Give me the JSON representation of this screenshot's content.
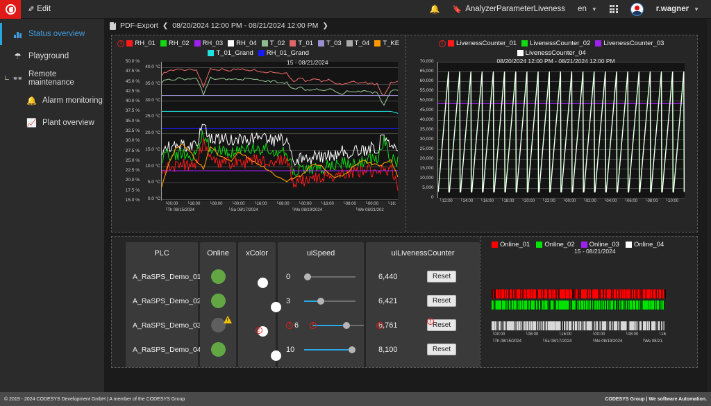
{
  "topbar": {
    "logo_name": "codesys-logo",
    "edit_label": "Edit",
    "notifications_icon": "bell-icon",
    "bookmark_label": "AnalyzerParameterLiveness",
    "language": "en",
    "apps_icon": "grid-apps-icon",
    "avatar_icon": "user-avatar",
    "user": "r.wagner"
  },
  "sidebar": {
    "items": [
      {
        "label": "Status overview",
        "icon": "bar-chart-icon",
        "active": true,
        "sub": false,
        "group": false
      },
      {
        "label": "Playground",
        "icon": "playground-icon",
        "active": false,
        "sub": false,
        "group": false
      },
      {
        "label": "Remote maintenance",
        "icon": "binoculars-icon",
        "active": false,
        "sub": false,
        "group": true
      },
      {
        "label": "Alarm monitoring",
        "icon": "alarm-bell-icon",
        "active": false,
        "sub": true,
        "group": false
      },
      {
        "label": "Plant overview",
        "icon": "plant-icon",
        "active": false,
        "sub": true,
        "group": false
      }
    ]
  },
  "breadcrumb": {
    "export_label": "PDF-Export",
    "prev_icon": "chevron-left-icon",
    "range": "08/20/2024 12:00 PM - 08/21/2024 12:00 PM",
    "next_icon": "chevron-right-icon"
  },
  "chart_data": [
    {
      "id": "trend-chart-temperature-humidity",
      "type": "line",
      "title": "15 - 08/21/2024",
      "legend_position": "top",
      "grid": true,
      "legend": [
        {
          "name": "RH_01",
          "color": "#ff1a1a",
          "error": true
        },
        {
          "name": "RH_02",
          "color": "#12d912",
          "error": false
        },
        {
          "name": "RH_03",
          "color": "#a020f0",
          "error": false
        },
        {
          "name": "RH_04",
          "color": "#ffffff",
          "error": false
        },
        {
          "name": "T_02",
          "color": "#8fbc8f",
          "error": false
        },
        {
          "name": "T_01",
          "color": "#e06666",
          "error": false
        },
        {
          "name": "T_03",
          "color": "#9b8fd4",
          "error": false
        },
        {
          "name": "T_04",
          "color": "#a9a9a9",
          "error": false
        },
        {
          "name": "T_KE",
          "color": "#ff9900",
          "error": false
        },
        {
          "name": "T_01_Grand",
          "color": "#22e0e0",
          "error": false
        },
        {
          "name": "RH_01_Grand",
          "color": "#1a1aff",
          "error": false
        }
      ],
      "yaxis_left": {
        "label": "%",
        "ticks": [
          "50.0 %",
          "47.5 %",
          "45.0 %",
          "42.5 %",
          "40.0 %",
          "37.5 %",
          "35.0 %",
          "32.5 %",
          "30.0 %",
          "27.5 %",
          "25.0 %",
          "22.5 %",
          "20.0 %",
          "17.5 %",
          "15.0 %"
        ],
        "min": 15.0,
        "max": 50.0
      },
      "yaxis_right_inner": {
        "label": "°C",
        "ticks": [
          "40.0 °C",
          "35.0 °C",
          "30.0 °C",
          "25.0 °C",
          "20.0 °C",
          "15.0 °C",
          "10.0 °C",
          "5.0 °C",
          "0.0 °C"
        ],
        "min": 0.0,
        "max": 40.0
      },
      "xaxis": {
        "ticks": [
          "00:00",
          "16:00",
          "08:00",
          "00:00",
          "16:00",
          "08:00",
          "00:00",
          "16:00",
          "08:00",
          "00:00",
          "16:"
        ],
        "day_labels": [
          "Th 08/15/2024",
          "Sa 08/17/2024",
          "Mo 08/19/2024",
          "We 08/21/202"
        ]
      },
      "series": [
        {
          "name": "T_01",
          "color": "#e06666",
          "values": [
            38.5,
            39.2,
            39.4,
            39.3,
            39.5,
            39.4,
            36.0,
            39.6,
            39.5,
            39.4,
            39.3,
            39.5,
            39.4,
            39.3,
            39.2,
            39.0,
            38.9,
            38.8,
            38.6,
            37.2,
            37.6,
            37.0,
            37.4,
            37.1,
            37.3,
            36.8,
            36.2,
            37.0,
            36.9,
            36.8,
            36.6,
            36.5,
            33.9,
            37.0,
            36.9
          ]
        },
        {
          "name": "T_02",
          "color": "#8fbc8f",
          "values": [
            37.0,
            37.4,
            37.6,
            37.5,
            37.6,
            37.5,
            34.5,
            37.7,
            37.6,
            37.5,
            37.4,
            37.6,
            37.5,
            37.4,
            37.3,
            37.1,
            37.0,
            36.9,
            36.7,
            35.4,
            35.8,
            35.2,
            35.6,
            35.3,
            35.5,
            35.0,
            34.4,
            35.2,
            35.1,
            35.0,
            34.8,
            34.7,
            32.1,
            35.2,
            35.1
          ]
        },
        {
          "name": "T_03",
          "color": "#9b8fd4",
          "values": [
            34.2,
            34.2,
            34.2,
            34.2,
            34.2,
            34.2,
            34.2,
            34.2,
            34.2,
            34.2,
            34.2,
            34.2,
            34.2,
            34.2,
            34.2,
            34.2,
            34.2,
            34.2,
            34.2,
            34.2,
            34.2,
            34.2,
            34.2,
            34.2,
            34.2,
            34.2,
            34.2,
            34.2,
            34.2,
            34.2,
            34.2,
            34.2,
            34.2,
            34.2,
            34.2
          ]
        },
        {
          "name": "T_01_Grand",
          "color": "#22e0e0",
          "values": [
            31.0,
            31.0,
            31.0,
            31.0,
            31.0,
            31.0,
            31.0,
            31.0,
            31.0,
            31.0,
            31.0,
            31.0,
            31.0,
            31.0,
            31.0,
            31.0,
            31.0,
            31.0,
            31.0,
            31.0,
            31.0,
            31.0,
            31.0,
            31.0,
            31.0,
            31.0,
            31.0,
            31.0,
            31.0,
            31.0,
            31.0,
            31.0,
            31.0,
            31.0,
            30.6
          ]
        },
        {
          "name": "RH_01_Grand",
          "color": "#1a1aff",
          "values": [
            27.5,
            27.5,
            27.5,
            27.5,
            27.5,
            27.5,
            27.5,
            27.5,
            27.5,
            27.5,
            27.5,
            27.5,
            27.5,
            27.5,
            27.5,
            27.5,
            27.5,
            27.5,
            27.5,
            27.5,
            27.5,
            27.5,
            27.5,
            27.5,
            27.5,
            27.5,
            27.5,
            27.5,
            27.5,
            27.5,
            27.5,
            27.5,
            27.5,
            27.5,
            27.5
          ]
        },
        {
          "name": "RH_04",
          "color": "#ffffff",
          "values": [
            23.5,
            24.0,
            23.8,
            24.2,
            23.9,
            24.4,
            28.5,
            25.6,
            25.2,
            25.4,
            25.1,
            25.5,
            25.2,
            25.6,
            25.3,
            25.5,
            25.0,
            25.4,
            25.1,
            20.8,
            21.5,
            21.2,
            22.0,
            21.6,
            22.4,
            22.0,
            23.0,
            22.6,
            23.4,
            23.0,
            23.6,
            23.2,
            26.8,
            23.4,
            23.0
          ]
        },
        {
          "name": "RH_02",
          "color": "#12d912",
          "values": [
            21.8,
            22.2,
            22.0,
            22.4,
            22.1,
            22.6,
            26.8,
            23.4,
            23.0,
            23.2,
            22.9,
            23.3,
            23.0,
            23.4,
            23.1,
            23.3,
            22.8,
            23.2,
            22.9,
            18.6,
            19.3,
            19.0,
            19.8,
            19.4,
            20.2,
            19.8,
            20.8,
            20.4,
            21.2,
            20.8,
            21.4,
            21.0,
            25.0,
            21.2,
            20.8
          ]
        },
        {
          "name": "RH_01",
          "color": "#ff1a1a",
          "values": [
            19.6,
            20.0,
            19.8,
            20.2,
            19.9,
            20.4,
            25.2,
            21.2,
            20.8,
            21.0,
            20.7,
            21.1,
            20.8,
            21.2,
            20.9,
            21.1,
            20.6,
            21.0,
            20.7,
            16.4,
            17.1,
            16.8,
            17.6,
            17.2,
            18.0,
            17.6,
            18.6,
            18.2,
            19.0,
            18.6,
            19.2,
            18.8,
            19.0,
            19.0,
            15.5
          ]
        },
        {
          "name": "RH_03",
          "color": "#a020f0",
          "values": [
            19.0,
            19.0,
            19.0,
            19.0,
            19.0,
            19.0,
            19.0,
            19.0,
            19.0,
            19.0,
            19.0,
            19.0,
            19.0,
            19.0,
            19.0,
            19.0,
            19.0,
            19.0,
            19.0,
            19.0,
            19.0,
            19.0,
            19.0,
            19.0,
            19.0,
            19.0,
            19.0,
            19.0,
            19.0,
            19.0,
            19.0,
            19.0,
            19.0,
            19.0,
            19.0
          ]
        },
        {
          "name": "T_KE",
          "color": "#ff9900",
          "values": [
            16.0,
            20.5,
            23.5,
            24.5,
            23.0,
            21.0,
            19.5,
            24.0,
            22.5,
            21.5,
            21.0,
            22.6,
            22.0,
            21.0,
            20.2,
            19.4,
            18.5,
            17.6,
            17.0,
            17.4,
            18.0,
            19.2,
            20.5,
            20.0,
            18.6,
            17.6,
            18.0,
            19.0,
            20.2,
            21.0,
            20.6,
            20.0,
            20.4,
            21.4,
            17.5
          ]
        }
      ]
    },
    {
      "id": "liveness-counter-chart",
      "type": "line",
      "title": "08/20/2024 12:00 PM - 08/21/2024 12:00 PM",
      "legend_position": "top",
      "grid": true,
      "legend": [
        {
          "name": "LivenessCounter_01",
          "color": "#ff1a1a",
          "error": true
        },
        {
          "name": "LivenessCounter_02",
          "color": "#12d912",
          "error": false
        },
        {
          "name": "LivenessCounter_03",
          "color": "#a020f0",
          "error": false
        },
        {
          "name": "LivenessCounter_04",
          "color": "#ffffff",
          "error": false
        }
      ],
      "yaxis": {
        "ticks": [
          "70,000",
          "65,000",
          "60,000",
          "55,000",
          "50,000",
          "45,000",
          "40,000",
          "35,000",
          "30,000",
          "25,000",
          "20,000",
          "15,000",
          "10,000",
          "5,000",
          "0"
        ],
        "min": 0,
        "max": 70000
      },
      "xaxis": {
        "ticks": [
          "12:00",
          "14:00",
          "16:00",
          "18:00",
          "20:00",
          "22:00",
          "00:00",
          "02:00",
          "04:00",
          "06:00",
          "08:00",
          "10:00"
        ]
      },
      "series": [
        {
          "name": "LivenessCounter_03",
          "color": "#a020f0",
          "constant": 48500
        },
        {
          "name": "LivenessCounter_02",
          "color": "#12d912",
          "sawtooth": true,
          "peak": 65000,
          "trough": 3000,
          "cycles": 22
        },
        {
          "name": "LivenessCounter_04",
          "color": "#ffffff",
          "sawtooth": true,
          "peak": 65000,
          "trough": 3000,
          "cycles": 22
        }
      ]
    },
    {
      "id": "online-status-strips",
      "type": "heatmap",
      "title": "15 - 08/21/2024",
      "legend": [
        {
          "name": "Online_01",
          "color": "#ff0000"
        },
        {
          "name": "Online_02",
          "color": "#00e400"
        },
        {
          "name": "Online_03",
          "color": "#a020f0"
        },
        {
          "name": "Online_04",
          "color": "#ffffff"
        }
      ],
      "xaxis": {
        "ticks": [
          "00:00",
          "08:00",
          "16:00",
          "00:00",
          "08:00",
          "16"
        ],
        "day_labels": [
          "Th 08/15/2024",
          "Sa 08/17/2024",
          "Mo 08/19/2024",
          "We 08/21."
        ]
      },
      "strips": [
        {
          "name": "Online_01",
          "color": "#ff0000"
        },
        {
          "name": "Online_02",
          "color": "#00e400"
        },
        {
          "name": "Online_04",
          "color": "#d8d8d8"
        }
      ]
    }
  ],
  "plc_table": {
    "columns": [
      "PLC",
      "Online",
      "xColor",
      "uiSpeed",
      "uiLivenessCounter"
    ],
    "reset_label": "Reset",
    "rows": [
      {
        "plc": "A_RaSPS_Demo_01",
        "online": "green",
        "warning": false,
        "xcolor": "off",
        "xcolor_error": false,
        "speed": "0",
        "speed_pct": 0,
        "liveness": "6,440",
        "liveness_error": false,
        "reset_error": false
      },
      {
        "plc": "A_RaSPS_Demo_02",
        "online": "green",
        "warning": false,
        "xcolor": "on",
        "xcolor_error": false,
        "speed": "3",
        "speed_pct": 30,
        "liveness": "6,421",
        "liveness_error": false,
        "reset_error": false
      },
      {
        "plc": "A_RaSPS_Demo_03",
        "online": "gray",
        "warning": true,
        "xcolor": "off",
        "xcolor_error": true,
        "speed": "6",
        "speed_pct": 68,
        "liveness": "6,761",
        "liveness_error": true,
        "reset_error": true
      },
      {
        "plc": "A_RaSPS_Demo_04",
        "online": "green",
        "warning": false,
        "xcolor": "on",
        "xcolor_error": false,
        "speed": "10",
        "speed_pct": 100,
        "liveness": "8,100",
        "liveness_error": false,
        "reset_error": false
      }
    ]
  },
  "footer": {
    "left": "© 2019 - 2024 CODESYS Development GmbH | A member of the CODESYS Group",
    "right": "CODESYS Group | We software Automation."
  }
}
